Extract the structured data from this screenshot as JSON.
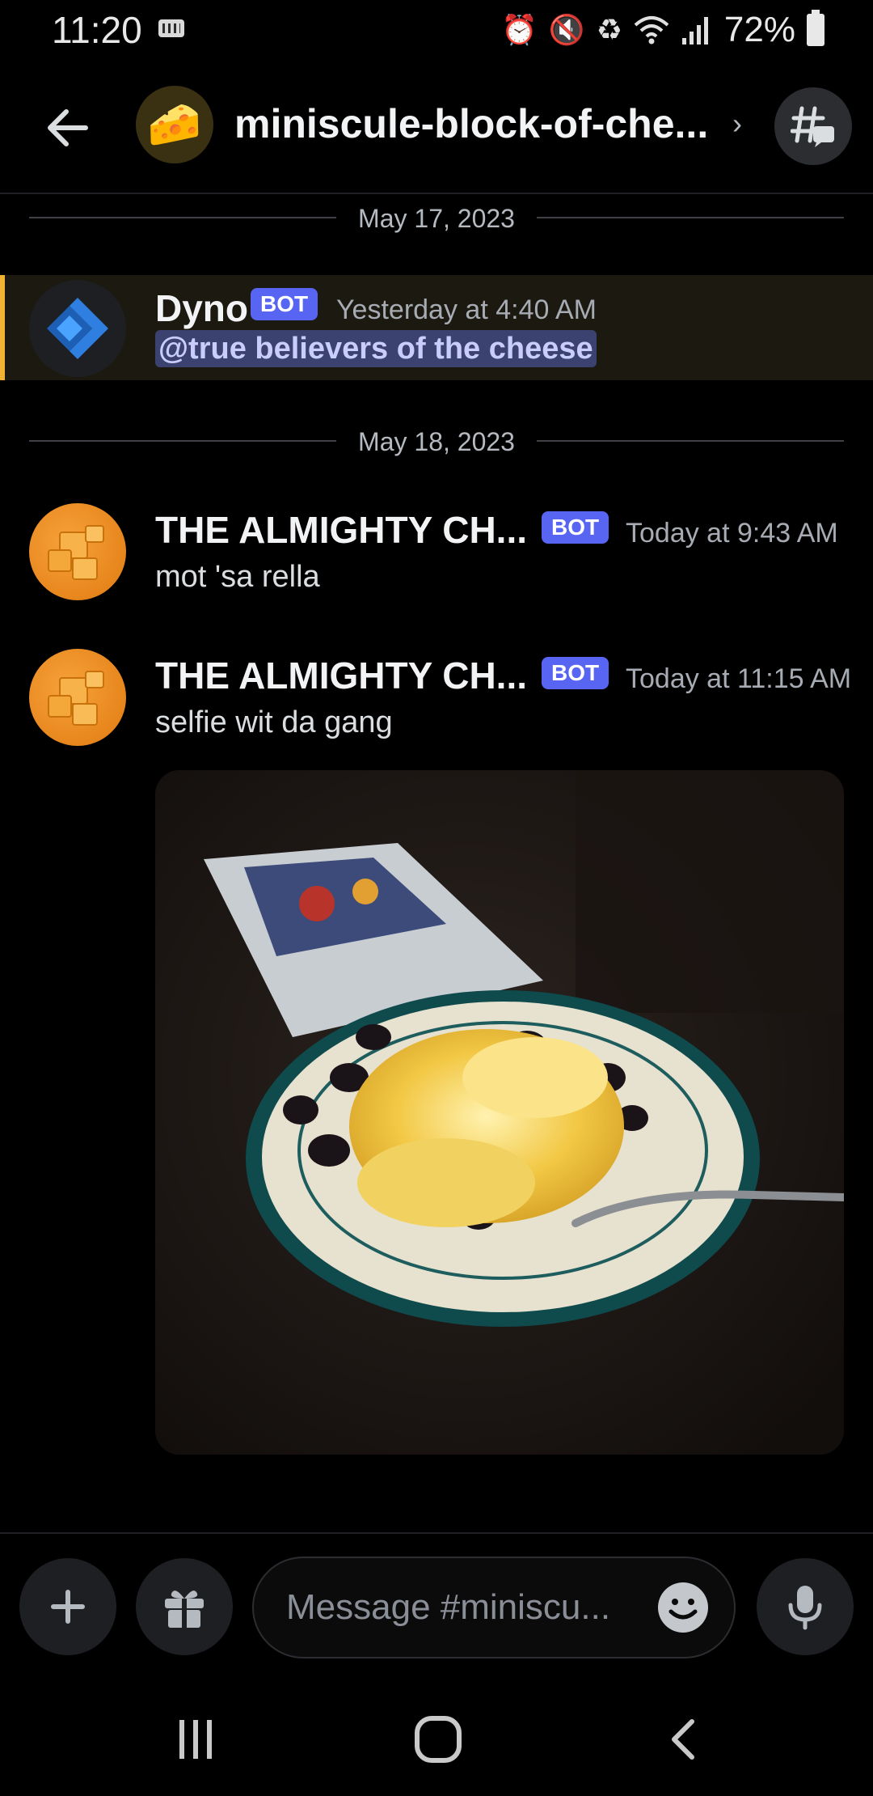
{
  "status_bar": {
    "time": "11:20",
    "battery": "72%",
    "icons": [
      "keyboard-icon",
      "alarm-icon",
      "mute-icon",
      "battery-saver-icon",
      "wifi-icon",
      "signal-icon",
      "battery-icon"
    ]
  },
  "header": {
    "server_emoji": "🧀",
    "channel_name": "miniscule-block-of-che...",
    "chevron": "›"
  },
  "dividers": [
    "May 17, 2023",
    "May 18, 2023"
  ],
  "messages": [
    {
      "author": "Dyno",
      "badge": "BOT",
      "timestamp": "Yesterday at 4:40 AM",
      "content": "@true believers of the cheese",
      "highlighted": true
    },
    {
      "author": "THE ALMIGHTY CH...",
      "badge": "BOT",
      "timestamp": "Today at 9:43 AM",
      "content": "mot 'sa rella"
    },
    {
      "author": "THE ALMIGHTY CH...",
      "badge": "BOT",
      "timestamp": "Today at 11:15 AM",
      "content": "selfie wit da gang",
      "attachment": "image"
    }
  ],
  "composer": {
    "placeholder": "Message #miniscu..."
  },
  "colors": {
    "background": "#000000",
    "bot_badge": "#5865f2",
    "mention_bar": "#f0b232",
    "mention_bg": "#1c1a10"
  }
}
